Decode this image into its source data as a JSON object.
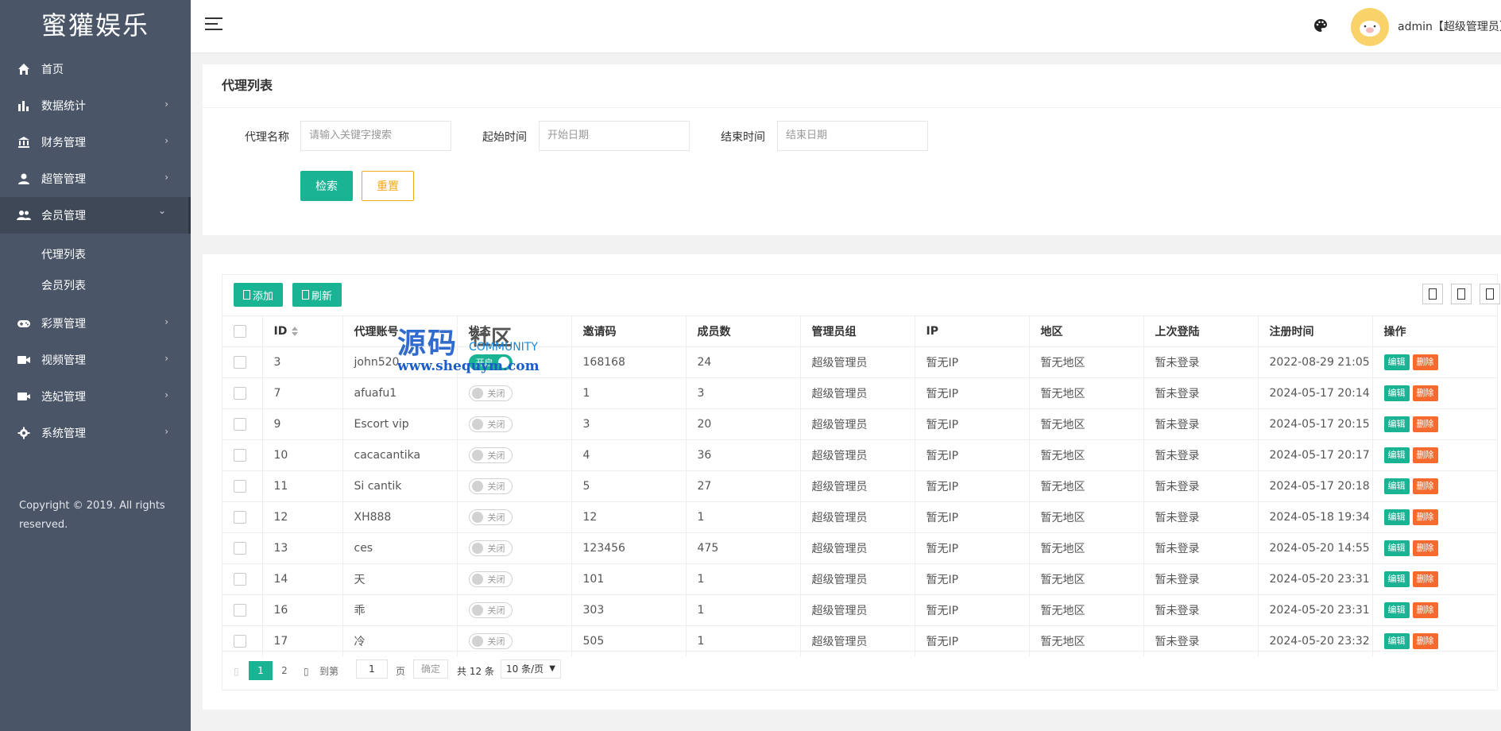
{
  "sidebar": {
    "logo": "蜜獾娱乐",
    "items": [
      {
        "label": "首页",
        "icon": "home-icon",
        "has_arrow": false
      },
      {
        "label": "数据统计",
        "icon": "bar-chart-icon",
        "has_arrow": true
      },
      {
        "label": "财务管理",
        "icon": "bank-icon",
        "has_arrow": true
      },
      {
        "label": "超管管理",
        "icon": "user-icon",
        "has_arrow": true
      },
      {
        "label": "会员管理",
        "icon": "users-icon",
        "has_arrow": true,
        "expanded": true
      },
      {
        "label": "彩票管理",
        "icon": "gamepad-icon",
        "has_arrow": true
      },
      {
        "label": "视频管理",
        "icon": "video-icon",
        "has_arrow": true
      },
      {
        "label": "选妃管理",
        "icon": "camera-icon",
        "has_arrow": true
      },
      {
        "label": "系统管理",
        "icon": "gear-icon",
        "has_arrow": true
      }
    ],
    "subitems": [
      {
        "label": "代理列表"
      },
      {
        "label": "会员列表"
      }
    ],
    "copyright": "Copyright © 2019. All rights reserved."
  },
  "header": {
    "user_label": "admin【超级管理员】"
  },
  "search_panel": {
    "title": "代理列表",
    "name_label": "代理名称",
    "name_placeholder": "请输入关键字搜索",
    "start_label": "起始时间",
    "start_placeholder": "开始日期",
    "end_label": "结束时间",
    "end_placeholder": "结束日期",
    "search_button": "检索",
    "reset_button": "重置"
  },
  "toolbar": {
    "add_label": "添加",
    "refresh_label": "刷新"
  },
  "table": {
    "columns": [
      "ID",
      "代理账号",
      "状态",
      "邀请码",
      "成员数",
      "管理员组",
      "IP",
      "地区",
      "上次登陆",
      "注册时间",
      "操作"
    ],
    "rows": [
      {
        "id": "3",
        "account": "john520",
        "status": "开启",
        "status_on": true,
        "code": "168168",
        "members": "24",
        "group": "超级管理员",
        "ip": "暂无IP",
        "region": "暂无地区",
        "last_login": "暂未登录",
        "reg_time": "2022-08-29 21:05"
      },
      {
        "id": "7",
        "account": "afuafu1",
        "status": "关闭",
        "status_on": false,
        "code": "1",
        "members": "3",
        "group": "超级管理员",
        "ip": "暂无IP",
        "region": "暂无地区",
        "last_login": "暂未登录",
        "reg_time": "2024-05-17 20:14"
      },
      {
        "id": "9",
        "account": "Escort vip",
        "status": "关闭",
        "status_on": false,
        "code": "3",
        "members": "20",
        "group": "超级管理员",
        "ip": "暂无IP",
        "region": "暂无地区",
        "last_login": "暂未登录",
        "reg_time": "2024-05-17 20:15"
      },
      {
        "id": "10",
        "account": "cacacantika",
        "status": "关闭",
        "status_on": false,
        "code": "4",
        "members": "36",
        "group": "超级管理员",
        "ip": "暂无IP",
        "region": "暂无地区",
        "last_login": "暂未登录",
        "reg_time": "2024-05-17 20:17"
      },
      {
        "id": "11",
        "account": "Si cantik",
        "status": "关闭",
        "status_on": false,
        "code": "5",
        "members": "27",
        "group": "超级管理员",
        "ip": "暂无IP",
        "region": "暂无地区",
        "last_login": "暂未登录",
        "reg_time": "2024-05-17 20:18"
      },
      {
        "id": "12",
        "account": "XH888",
        "status": "关闭",
        "status_on": false,
        "code": "12",
        "members": "1",
        "group": "超级管理员",
        "ip": "暂无IP",
        "region": "暂无地区",
        "last_login": "暂未登录",
        "reg_time": "2024-05-18 19:34"
      },
      {
        "id": "13",
        "account": "ces",
        "status": "关闭",
        "status_on": false,
        "code": "123456",
        "members": "475",
        "group": "超级管理员",
        "ip": "暂无IP",
        "region": "暂无地区",
        "last_login": "暂未登录",
        "reg_time": "2024-05-20 14:55"
      },
      {
        "id": "14",
        "account": "天",
        "status": "关闭",
        "status_on": false,
        "code": "101",
        "members": "1",
        "group": "超级管理员",
        "ip": "暂无IP",
        "region": "暂无地区",
        "last_login": "暂未登录",
        "reg_time": "2024-05-20 23:31"
      },
      {
        "id": "16",
        "account": "乖",
        "status": "关闭",
        "status_on": false,
        "code": "303",
        "members": "1",
        "group": "超级管理员",
        "ip": "暂无IP",
        "region": "暂无地区",
        "last_login": "暂未登录",
        "reg_time": "2024-05-20 23:31"
      },
      {
        "id": "17",
        "account": "冷",
        "status": "关闭",
        "status_on": false,
        "code": "505",
        "members": "1",
        "group": "超级管理员",
        "ip": "暂无IP",
        "region": "暂无地区",
        "last_login": "暂未登录",
        "reg_time": "2024-05-20 23:32"
      }
    ],
    "edit_label": "编辑",
    "delete_label": "删除"
  },
  "pager": {
    "pages": [
      "1",
      "2"
    ],
    "current": "1",
    "goto_label": "到第",
    "goto_value": "1",
    "page_suffix": "页",
    "confirm": "确定",
    "total": "共 12 条",
    "limit": "10 条/页"
  },
  "watermark": {
    "big": "源码",
    "small_top": "社区",
    "small": "COMMUNITY",
    "url": "www.shequym.com"
  },
  "colors": {
    "sidebar_bg": "#4a5568",
    "accent": "#1ab394",
    "reset": "#f0a818",
    "delete": "#f56b2f"
  }
}
